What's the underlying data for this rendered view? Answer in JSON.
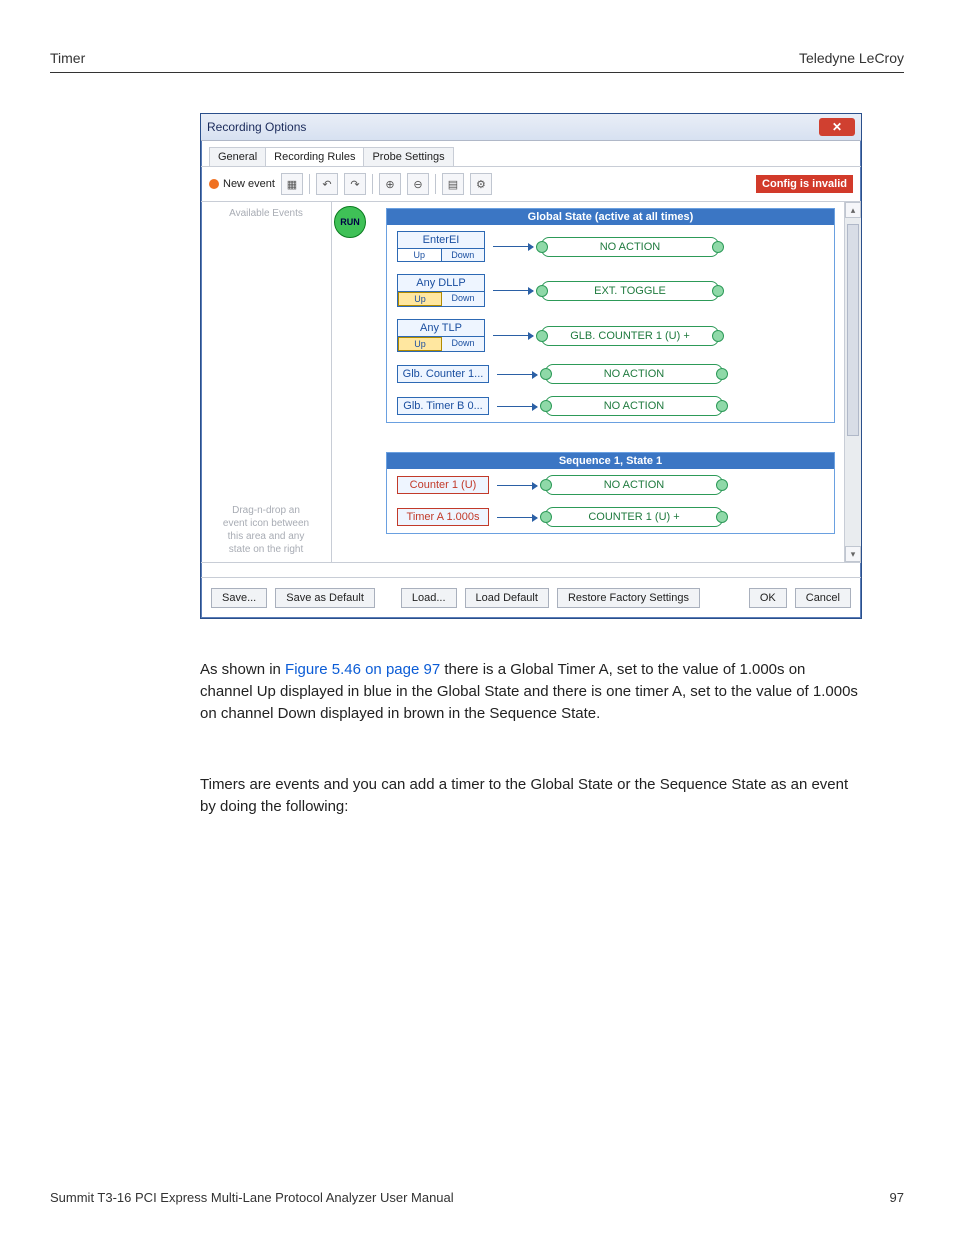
{
  "page": {
    "header_left": "Timer",
    "header_right": "Teledyne LeCroy",
    "footer_left": "Summit T3-16 PCI Express Multi-Lane Protocol Analyzer User Manual",
    "footer_right": "97"
  },
  "win": {
    "title": "Recording Options",
    "tabs": {
      "general": "General",
      "rules": "Recording Rules",
      "probe": "Probe Settings"
    },
    "toolbar": {
      "new_event": "New event",
      "config_invalid": "Config is invalid"
    },
    "left": {
      "available": "Available Events",
      "hint1": "Drag-n-drop an",
      "hint2": "event icon between",
      "hint3": "this area and any",
      "hint4": "state on the right"
    },
    "run": "RUN",
    "global": {
      "header": "Global State (active at all times)",
      "rows": [
        {
          "ev": "EnterEI",
          "up": "Up",
          "down": "Down",
          "action": "NO ACTION"
        },
        {
          "ev": "Any DLLP",
          "up": "Up",
          "down": "Down",
          "action": "EXT. TOGGLE"
        },
        {
          "ev": "Any TLP",
          "up": "Up",
          "down": "Down",
          "action": "GLB. COUNTER 1 (U) +"
        },
        {
          "ev": "Glb. Counter 1...",
          "action": "NO ACTION"
        },
        {
          "ev": "Glb. Timer B 0...",
          "action": "NO ACTION"
        }
      ]
    },
    "sequence": {
      "header": "Sequence 1, State 1",
      "rows": [
        {
          "ev": "Counter 1 (U)",
          "action": "NO ACTION"
        },
        {
          "ev": "Timer A 1.000s",
          "action": "COUNTER 1 (U) +"
        }
      ]
    },
    "footer": {
      "save": "Save...",
      "save_default": "Save as Default",
      "load": "Load...",
      "load_default": "Load Default",
      "restore": "Restore Factory Settings",
      "ok": "OK",
      "cancel": "Cancel"
    }
  },
  "para1_pre": "As shown in ",
  "para1_link": "Figure 5.46 on page 97",
  "para1_post": " there is a Global Timer A, set to the value of 1.000s on channel Up displayed in blue in the Global State and there is one timer A, set to the value of 1.000s on channel Down displayed in brown in the Sequence State.",
  "para2": "Timers are events and you can add a timer to the Global State or the Sequence State as an event by doing the following:"
}
